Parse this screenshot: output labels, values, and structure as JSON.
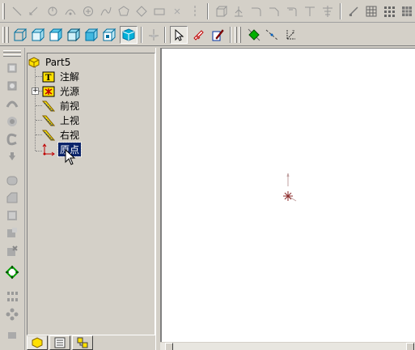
{
  "tree": {
    "root": {
      "label": "Part5",
      "icon": "part-icon"
    },
    "items": [
      {
        "label": "注解",
        "icon": "annotation-icon",
        "expandable": false,
        "selected": false
      },
      {
        "label": "光源",
        "icon": "lights-icon",
        "expandable": true,
        "selected": false
      },
      {
        "label": "前视",
        "icon": "plane-icon",
        "expandable": false,
        "selected": false
      },
      {
        "label": "上视",
        "icon": "plane-icon",
        "expandable": false,
        "selected": false
      },
      {
        "label": "右视",
        "icon": "plane-icon",
        "expandable": false,
        "selected": false
      },
      {
        "label": "原点",
        "icon": "origin-icon",
        "expandable": false,
        "selected": true
      }
    ]
  },
  "tabs": [
    {
      "name": "feature-manager-tab",
      "icon": "part-icon",
      "active": true
    },
    {
      "name": "property-manager-tab",
      "icon": "property-icon",
      "active": false
    },
    {
      "name": "configuration-manager-tab",
      "icon": "configuration-icon",
      "active": false
    }
  ],
  "colors": {
    "face": "#d4d0c8",
    "selection": "#0a246a",
    "viewport": "#ffffff",
    "origin": "#8b2a2a",
    "accent_cyan": "#00a0c0",
    "accent_green": "#00a000"
  }
}
